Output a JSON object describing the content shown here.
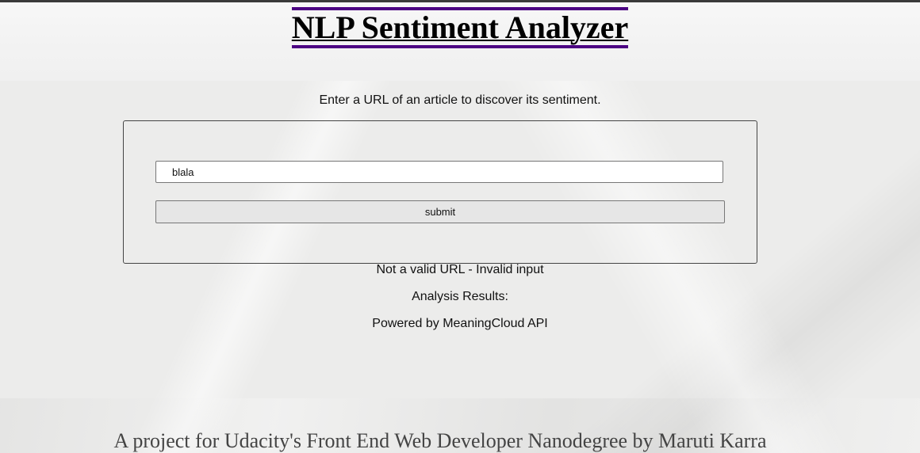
{
  "header": {
    "title": "NLP Sentiment Analyzer",
    "accent_color": "#4b0082"
  },
  "main": {
    "intro": "Enter a URL of an article to discover its sentiment.",
    "form": {
      "url_value": "blala",
      "submit_label": "submit"
    },
    "error_message": "Not a valid URL - Invalid input",
    "results_label": "Analysis Results:",
    "powered_by": "Powered by MeaningCloud API"
  },
  "footer": {
    "text": "A project for Udacity's Front End Web Developer Nanodegree by Maruti Karra"
  }
}
